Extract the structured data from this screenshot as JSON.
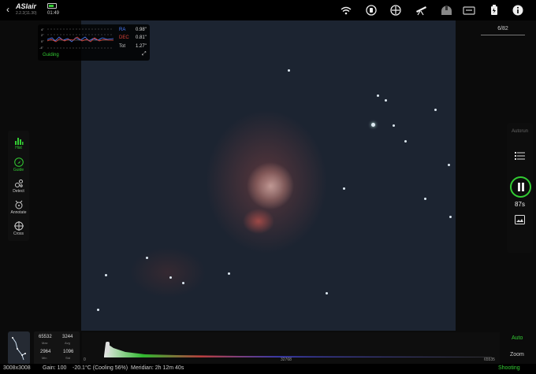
{
  "app": {
    "name": "ASIair",
    "version": "2.2.2(11.30)",
    "time": "01:49"
  },
  "top_icons": [
    "wifi-icon",
    "ir-icon",
    "mount-icon",
    "telescope-icon",
    "observatory-icon",
    "camera-icon",
    "battery-power-icon",
    "info-icon"
  ],
  "guide_graph": {
    "axis_top": "4\"",
    "axis_mid_top": "2\"",
    "axis_zero": "0\"",
    "axis_bottom": "-4\"",
    "rows": [
      {
        "label": "RA",
        "value": "0.98\"",
        "color": "#4a7dff"
      },
      {
        "label": "DEC",
        "value": "0.81\"",
        "color": "#e0443a"
      },
      {
        "label": "Tot",
        "value": "1.27\"",
        "color": "#cccccc"
      }
    ],
    "status": "Guiding"
  },
  "left_tools": [
    {
      "label": "Hist",
      "icon": "histogram-icon",
      "active": true
    },
    {
      "label": "Guide",
      "icon": "guide-icon",
      "active": true
    },
    {
      "label": "Detect",
      "icon": "detect-icon",
      "active": false
    },
    {
      "label": "Annotate",
      "icon": "annotate-icon",
      "active": false
    },
    {
      "label": "Cross",
      "icon": "crosshair-icon",
      "active": false
    }
  ],
  "frame_count": "6/82",
  "right_panel": {
    "autorun": "Autorun",
    "countdown": "87s"
  },
  "stats": {
    "max_value": "65532",
    "max_label": "Max",
    "avg_value": "3244",
    "avg_label": "Avg",
    "min_value": "2964",
    "min_label": "Min",
    "std_value": "1096",
    "std_label": "Std"
  },
  "histogram": {
    "left_label": "0",
    "mid_label": "32768",
    "right_label": "65535"
  },
  "bottom_right": {
    "auto": "Auto",
    "zoom": "Zoom"
  },
  "status_bar": {
    "resolution": "3008x3008",
    "gain": "Gain: 100",
    "temp": "-20.1°C (Cooling 56%)",
    "meridian": "Meridian: 2h 12m 40s",
    "state": "Shooting"
  },
  "colors": {
    "accent": "#33cc33",
    "ra": "#4a7dff",
    "dec": "#e0443a"
  }
}
